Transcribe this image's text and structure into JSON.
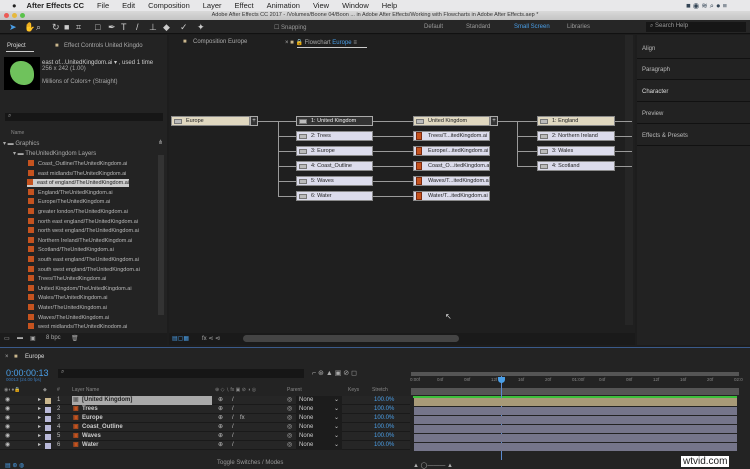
{
  "menubar": {
    "app": "After Effects CC",
    "items": [
      "File",
      "Edit",
      "Composition",
      "Layer",
      "Effect",
      "Animation",
      "View",
      "Window",
      "Help"
    ]
  },
  "window_title": "Adobe After Effects CC 2017 - /Volumes/Boone 04/Boon ... in Adobe After Effects/Working with Flowcharts in Adobe After Effects.aep *",
  "toolbar": {
    "snapping": "Snapping",
    "workspaces": [
      "Default",
      "Standard",
      "Small Screen",
      "Libraries"
    ],
    "active_workspace": "Small Screen",
    "search_placeholder": "Search Help"
  },
  "project": {
    "tab": "Project",
    "effect_tab": "Effect Controls United Kingdo",
    "asset_name": "east of...UnitedKingdom.ai ▾ , used 1 time",
    "asset_size": "256 x 242 (1.00)",
    "asset_colors": "Millions of Colors+ (Straight)",
    "column_name": "Name",
    "bpc": "8 bpc",
    "folder": "Graphics",
    "subfolder": "TheUnitedKingdom Layers",
    "items": [
      "Coast_Outline/TheUnitedKingdom.ai",
      "east midlands/TheUnitedKingdom.ai",
      "east of england/TheUnitedKingdom.ai",
      "England/TheUnitedKingdom.ai",
      "Europe/TheUnitedKingdom.ai",
      "greater london/TheUnitedKingdom.ai",
      "north east england/TheUnitedKingdom.ai",
      "north west england/TheUnitedKingdom.ai",
      "Northern Ireland/TheUnitedKingdom.ai",
      "Scotland/TheUnitedKingdom.ai",
      "south east england/TheUnitedKingdom.ai",
      "south west england/TheUnitedKingdom.ai",
      "Trees/TheUnitedKingdom.ai",
      "United Kingdom/TheUnitedKingdom.ai",
      "Wales/TheUnitedKingdom.ai",
      "Water/TheUnitedKingdom.ai",
      "Waves/TheUnitedKingdom.ai",
      "west midlands/TheUnitedKinodom.ai"
    ],
    "selected_index": 2
  },
  "viewer": {
    "comp_tab": "Composition Europe",
    "flow_tab_prefix": "Flowchart",
    "flow_tab_name": "Europe"
  },
  "flowchart": {
    "root": "Europe",
    "layers": [
      "1: United Kingdom",
      "2: Trees",
      "3: Europe",
      "4: Coast_Outline",
      "5: Waves",
      "6: Water"
    ],
    "sources": [
      "United Kingdom",
      "Trees/T...itedKingdom.ai",
      "Europe/...itedKingdom.ai",
      "Coast_O...itedKingdom.ai",
      "Waves/T...itedKingdom.ai",
      "Water/T...itedKingdom.ai"
    ],
    "sublayers": [
      "1: England",
      "2: Northern Ireland",
      "3: Wales",
      "4: Scotland"
    ]
  },
  "right_panel": [
    "Align",
    "Paragraph",
    "Character",
    "Preview",
    "Effects & Presets"
  ],
  "timeline": {
    "tab": "Europe",
    "timecode": "0:00:00:13",
    "fps": "00013 (24.00 fps)",
    "headers": {
      "layer_name": "Layer Name",
      "parent": "Parent",
      "keys": "Keys",
      "stretch": "Stretch",
      "num": "#"
    },
    "layers": [
      {
        "n": "1",
        "name": "[United Kingdom]",
        "parent": "None",
        "stretch": "100.0%"
      },
      {
        "n": "2",
        "name": "Trees",
        "parent": "None",
        "stretch": "100.0%"
      },
      {
        "n": "3",
        "name": "Europe",
        "parent": "None",
        "stretch": "100.0%"
      },
      {
        "n": "4",
        "name": "Coast_Outline",
        "parent": "None",
        "stretch": "100.0%"
      },
      {
        "n": "5",
        "name": "Waves",
        "parent": "None",
        "stretch": "100.0%"
      },
      {
        "n": "6",
        "name": "Water",
        "parent": "None",
        "stretch": "100.0%"
      }
    ],
    "toggle": "Toggle Switches / Modes",
    "ruler": [
      "0:00f",
      "04f",
      "08f",
      "12f",
      "16f",
      "20f",
      "01:00f",
      "04f",
      "08f",
      "12f",
      "16f",
      "20f",
      "02:0"
    ],
    "playhead_frame": 13
  },
  "watermark": "wtvid.com",
  "colors": {
    "accent": "#4a9fe8",
    "comp_label": "#c9b68d",
    "layer_label": "#b8b8d8"
  }
}
